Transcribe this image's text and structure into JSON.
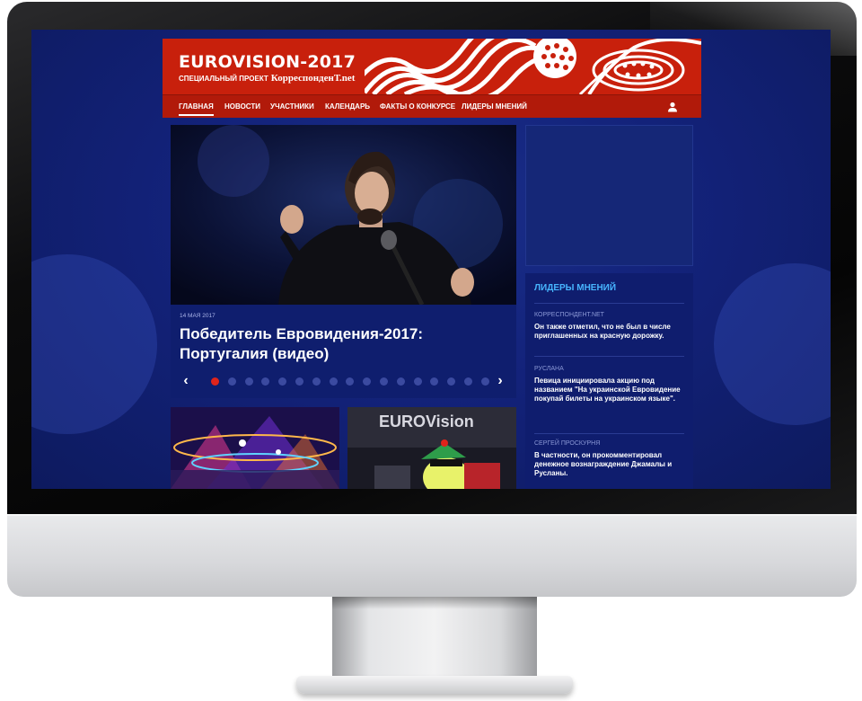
{
  "header": {
    "brand": "EUROVISION-2017",
    "subtitle": "СПЕЦИАЛЬНЫЙ ПРОЕКТ",
    "partner_logo": "КорреспонденТ.net",
    "accent_color": "#c8200c"
  },
  "nav": {
    "items": [
      {
        "label": "ГЛАВНАЯ"
      },
      {
        "label": "НОВОСТИ"
      },
      {
        "label": "УЧАСТНИКИ"
      },
      {
        "label": "КАЛЕНДАРЬ"
      },
      {
        "label": "ФАКТЫ О КОНКУРСЕ"
      },
      {
        "label": "ЛИДЕРЫ МНЕНИЙ"
      }
    ],
    "active_index": 0,
    "user_icon": "user-icon"
  },
  "slider": {
    "date": "14 МАЯ 2017",
    "title": "Победитель Евровидения-2017: Португалия (видео)",
    "prev_icon": "chevron-left-icon",
    "next_icon": "chevron-right-icon",
    "dot_count": 17,
    "active_dot": 0
  },
  "thumbnails": [
    {
      "image": "stage-lights-photo"
    },
    {
      "image": "eurovision-sign-photo",
      "sign_text": "EUROVision"
    }
  ],
  "leaders": {
    "title": "ЛИДЕРЫ МНЕНИЙ",
    "items": [
      {
        "name": "КОРРЕСПОНДЕНТ.NET",
        "text": "Он также отметил, что не был в числе приглашенных на красную дорожку."
      },
      {
        "name": "РУСЛАНА",
        "text": "Певица инициировала акцию под названием \"На украинской Евровидение покупай билеты на украинском языке\"."
      },
      {
        "name": "СЕРГЕЙ ПРОСКУРНЯ",
        "text": "В частности, он прокомментировал денежное вознаграждение Джамалы и Русланы."
      }
    ]
  }
}
